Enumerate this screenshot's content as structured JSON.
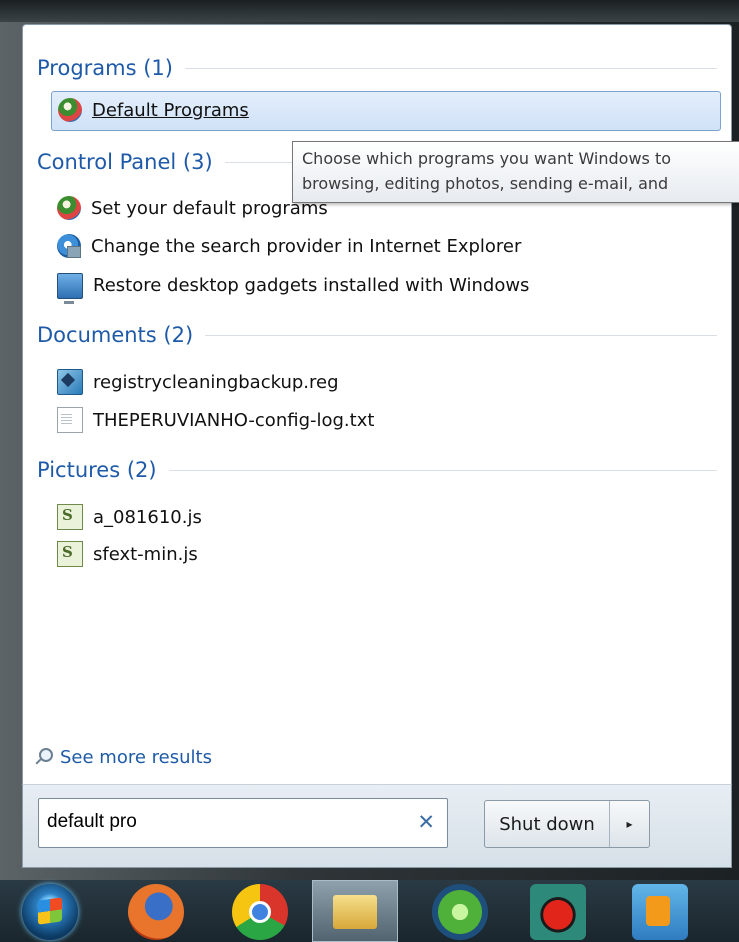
{
  "groups": {
    "programs": {
      "title": "Programs (1)",
      "items": [
        {
          "label": "Default Programs",
          "icon": "default-programs-icon"
        }
      ]
    },
    "control_panel": {
      "title": "Control Panel (3)",
      "items": [
        {
          "label": "Set your default programs",
          "icon": "default-programs-icon"
        },
        {
          "label": "Change the search provider in Internet Explorer",
          "icon": "internet-explorer-icon"
        },
        {
          "label": "Restore desktop gadgets installed with Windows",
          "icon": "gadgets-icon"
        }
      ]
    },
    "documents": {
      "title": "Documents (2)",
      "items": [
        {
          "label": "registrycleaningbackup.reg",
          "icon": "registry-file-icon"
        },
        {
          "label": "THEPERUVIANHO-config-log.txt",
          "icon": "text-file-icon"
        }
      ]
    },
    "pictures": {
      "title": "Pictures (2)",
      "items": [
        {
          "label": "a_081610.js",
          "icon": "script-file-icon"
        },
        {
          "label": "sfext-min.js",
          "icon": "script-file-icon"
        }
      ]
    }
  },
  "tooltip": {
    "line1": "Choose which programs you want Windows to",
    "line2": "browsing, editing photos, sending e-mail, and"
  },
  "see_more": "See more results",
  "search": {
    "value": "default pro",
    "clear_icon": "✕"
  },
  "shutdown": {
    "label": "Shut down",
    "arrow": "▸"
  },
  "taskbar": [
    "start-orb-icon",
    "firefox-icon",
    "chrome-icon",
    "windows-explorer-icon",
    "sims-icon",
    "ladybug-app-icon",
    "media-player-icon"
  ],
  "colors": {
    "accent_blue": "#1e5aa8",
    "selection": "#cfe2f7"
  }
}
